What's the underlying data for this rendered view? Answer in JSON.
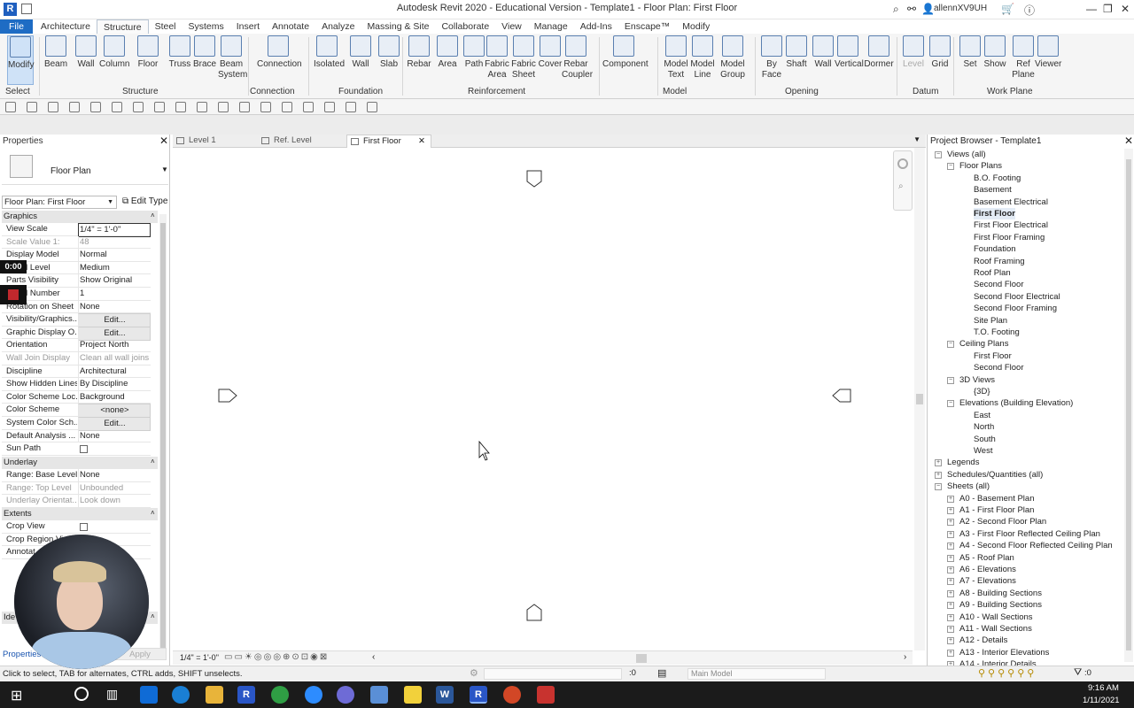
{
  "window": {
    "title": "Autodesk Revit 2020 - Educational Version - Template1 - Floor Plan: First Floor",
    "user": "allennXV9UH"
  },
  "menu": [
    "File",
    "Architecture",
    "Structure",
    "Steel",
    "Systems",
    "Insert",
    "Annotate",
    "Analyze",
    "Massing & Site",
    "Collaborate",
    "View",
    "Manage",
    "Add-Ins",
    "Enscape™",
    "Modify"
  ],
  "ribbon": {
    "buttons": [
      {
        "label": "Modify"
      },
      {
        "label": "Beam"
      },
      {
        "label": "Wall"
      },
      {
        "label": "Column"
      },
      {
        "label": "Floor"
      },
      {
        "label": "Truss"
      },
      {
        "label": "Brace"
      },
      {
        "label": "Beam\nSystem"
      },
      {
        "label": "Connection"
      },
      {
        "label": "Isolated"
      },
      {
        "label": "Wall"
      },
      {
        "label": "Slab"
      },
      {
        "label": "Rebar"
      },
      {
        "label": "Area"
      },
      {
        "label": "Path"
      },
      {
        "label": "Fabric\nArea"
      },
      {
        "label": "Fabric\nSheet"
      },
      {
        "label": "Cover"
      },
      {
        "label": "Rebar\nCoupler"
      },
      {
        "label": "Component"
      },
      {
        "label": "Model\nText"
      },
      {
        "label": "Model\nLine"
      },
      {
        "label": "Model\nGroup"
      },
      {
        "label": "By\nFace"
      },
      {
        "label": "Shaft"
      },
      {
        "label": "Wall"
      },
      {
        "label": "Vertical"
      },
      {
        "label": "Dormer"
      },
      {
        "label": "Level"
      },
      {
        "label": "Grid"
      },
      {
        "label": "Set"
      },
      {
        "label": "Show"
      },
      {
        "label": "Ref\nPlane"
      },
      {
        "label": "Viewer"
      }
    ],
    "groups": [
      "Select",
      "Structure",
      "Connection",
      "Foundation",
      "Reinforcement",
      "Model",
      "Opening",
      "Datum",
      "Work Plane"
    ]
  },
  "properties": {
    "header": "Properties",
    "type_name": "Floor Plan",
    "selector": "Floor Plan: First Floor",
    "edit_type": "Edit Type",
    "apply": "Apply",
    "help_link": "Properties help",
    "categories": {
      "graphics": "Graphics",
      "underlay": "Underlay",
      "extents": "Extents",
      "identity": "Ide"
    },
    "graphics_rows": [
      {
        "k": "View Scale",
        "v": "1/4\" = 1'-0\""
      },
      {
        "k": "Scale Value    1:",
        "v": "48"
      },
      {
        "k": "Display Model",
        "v": "Normal"
      },
      {
        "k": "Detail Level",
        "v": "Medium"
      },
      {
        "k": "Parts Visibility",
        "v": "Show Original"
      },
      {
        "k": "Detail Number",
        "v": "1"
      },
      {
        "k": "Rotation on Sheet",
        "v": "None"
      },
      {
        "k": "Visibility/Graphics...",
        "v": "Edit..."
      },
      {
        "k": "Graphic Display O...",
        "v": "Edit..."
      },
      {
        "k": "Orientation",
        "v": "Project North"
      },
      {
        "k": "Wall Join Display",
        "v": "Clean all wall joins"
      },
      {
        "k": "Discipline",
        "v": "Architectural"
      },
      {
        "k": "Show Hidden Lines",
        "v": "By Discipline"
      },
      {
        "k": "Color Scheme Loc...",
        "v": "Background"
      },
      {
        "k": "Color Scheme",
        "v": "<none>"
      },
      {
        "k": "System Color Sch...",
        "v": "Edit..."
      },
      {
        "k": "Default Analysis ...",
        "v": "None"
      },
      {
        "k": "Sun Path",
        "v": ""
      }
    ],
    "underlay_rows": [
      {
        "k": "Range: Base Level",
        "v": "None"
      },
      {
        "k": "Range: Top Level",
        "v": "Unbounded"
      },
      {
        "k": "Underlay Orientat...",
        "v": "Look down"
      }
    ],
    "extents_rows": [
      {
        "k": "Crop View",
        "v": ""
      },
      {
        "k": "Crop Region Vi...",
        "v": ""
      },
      {
        "k": "Annotat...",
        "v": ""
      }
    ],
    "timer": "0:00"
  },
  "tabs": [
    {
      "label": "Level 1"
    },
    {
      "label": "Ref. Level"
    },
    {
      "label": "First Floor"
    }
  ],
  "view": {
    "scale": "1/4\" = 1'-0\""
  },
  "browser": {
    "title": "Project Browser - Template1",
    "nodes": [
      {
        "label": "Views (all)",
        "indent": 0
      },
      {
        "label": "Floor Plans",
        "indent": 1
      },
      {
        "label": "B.O. Footing",
        "indent": 2
      },
      {
        "label": "Basement",
        "indent": 2
      },
      {
        "label": "Basement Electrical",
        "indent": 2
      },
      {
        "label": "First Floor",
        "indent": 2,
        "bold": true
      },
      {
        "label": "First Floor Electrical",
        "indent": 2
      },
      {
        "label": "First Floor Framing",
        "indent": 2
      },
      {
        "label": "Foundation",
        "indent": 2
      },
      {
        "label": "Roof Framing",
        "indent": 2
      },
      {
        "label": "Roof Plan",
        "indent": 2
      },
      {
        "label": "Second Floor",
        "indent": 2
      },
      {
        "label": "Second Floor Electrical",
        "indent": 2
      },
      {
        "label": "Second Floor Framing",
        "indent": 2
      },
      {
        "label": "Site Plan",
        "indent": 2
      },
      {
        "label": "T.O. Footing",
        "indent": 2
      },
      {
        "label": "Ceiling Plans",
        "indent": 1
      },
      {
        "label": "First Floor",
        "indent": 2
      },
      {
        "label": "Second Floor",
        "indent": 2
      },
      {
        "label": "3D Views",
        "indent": 1
      },
      {
        "label": "{3D}",
        "indent": 2
      },
      {
        "label": "Elevations (Building Elevation)",
        "indent": 1
      },
      {
        "label": "East",
        "indent": 2
      },
      {
        "label": "North",
        "indent": 2
      },
      {
        "label": "South",
        "indent": 2
      },
      {
        "label": "West",
        "indent": 2
      },
      {
        "label": "Legends",
        "indent": 0
      },
      {
        "label": "Schedules/Quantities (all)",
        "indent": 0
      },
      {
        "label": "Sheets (all)",
        "indent": 0
      },
      {
        "label": "A0 - Basement Plan",
        "indent": 1
      },
      {
        "label": "A1 - First Floor Plan",
        "indent": 1
      },
      {
        "label": "A2 - Second Floor Plan",
        "indent": 1
      },
      {
        "label": "A3 - First Floor Reflected Ceiling Plan",
        "indent": 1
      },
      {
        "label": "A4 - Second Floor Reflected Ceiling Plan",
        "indent": 1
      },
      {
        "label": "A5 - Roof Plan",
        "indent": 1
      },
      {
        "label": "A6 - Elevations",
        "indent": 1
      },
      {
        "label": "A7 - Elevations",
        "indent": 1
      },
      {
        "label": "A8 - Building Sections",
        "indent": 1
      },
      {
        "label": "A9 - Building Sections",
        "indent": 1
      },
      {
        "label": "A10 - Wall Sections",
        "indent": 1
      },
      {
        "label": "A11 - Wall Sections",
        "indent": 1
      },
      {
        "label": "A12 - Details",
        "indent": 1
      },
      {
        "label": "A13 - Interior Elevations",
        "indent": 1
      },
      {
        "label": "A14 - Interior Details",
        "indent": 1
      }
    ]
  },
  "status": {
    "hint": "Click to select, TAB for alternates, CTRL adds, SHIFT unselects.",
    "zero": ":0",
    "model": "Main Model",
    "filter": ":0"
  },
  "taskbar": {
    "time": "9:16 AM",
    "date": "1/11/2021"
  }
}
